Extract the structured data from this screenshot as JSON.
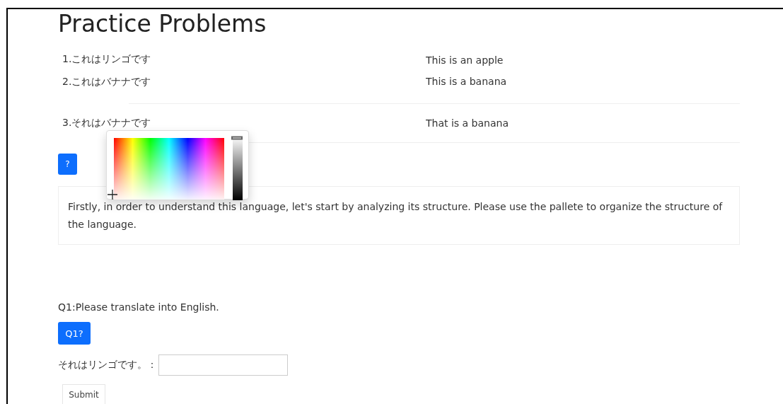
{
  "title": "Practice Problems",
  "problems": [
    {
      "japanese": "1.これはリンゴです",
      "english": "This is an apple"
    },
    {
      "japanese": "2.これはバナナです",
      "english": "This is a banana"
    },
    {
      "japanese": "3.それはバナナです",
      "english": "That is a banana"
    }
  ],
  "hint_button": "?",
  "color_picker": {
    "level": 1
  },
  "note": "Firstly, in order to understand this language, let's start by analyzing its structure. Please use the pallete to organize the structure of the language.",
  "question": {
    "prompt": "Q1:Please translate into English.",
    "button": "Q1?",
    "label": "それはリンゴです。：",
    "submit": "Submit"
  }
}
